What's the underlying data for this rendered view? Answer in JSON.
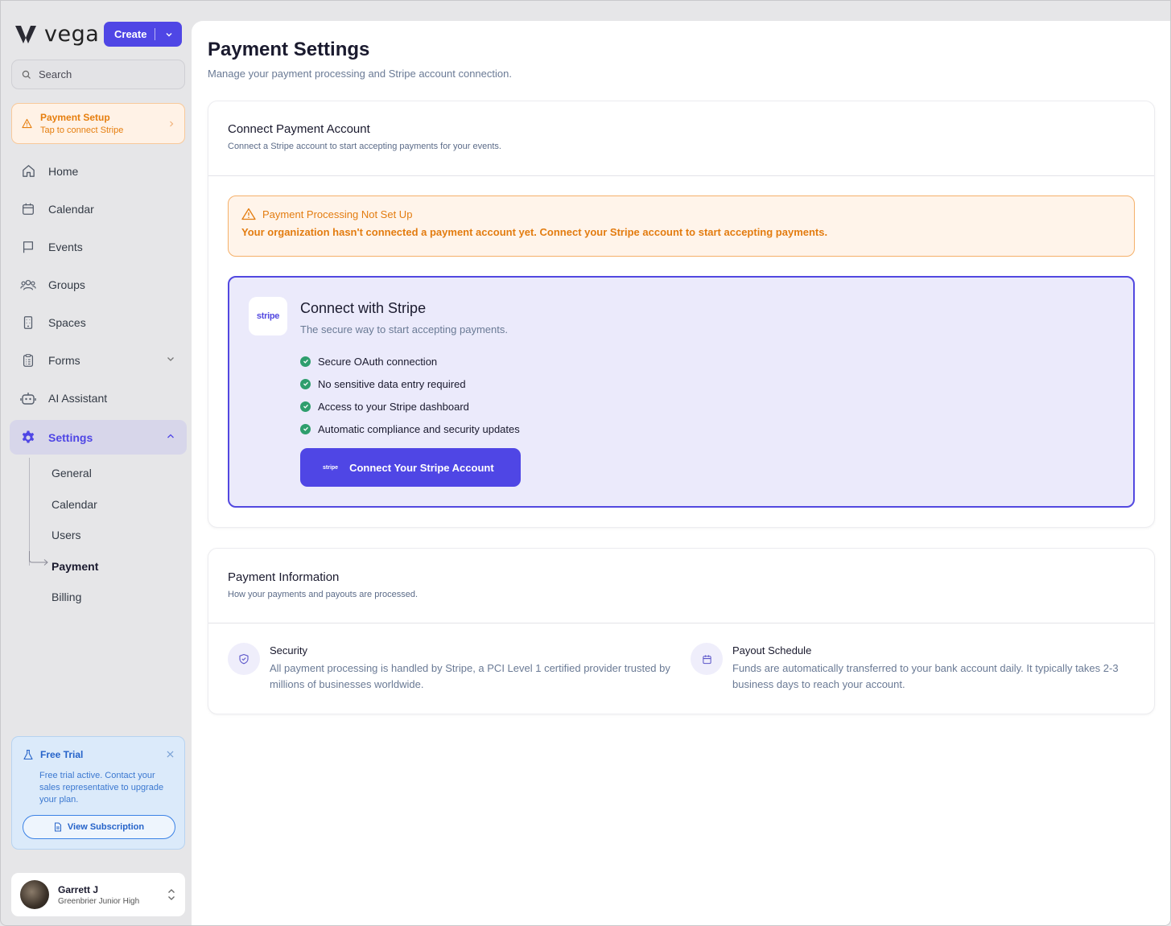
{
  "brand": {
    "name": "vega"
  },
  "create": {
    "label": "Create"
  },
  "search": {
    "placeholder": "Search"
  },
  "payment_setup": {
    "title": "Payment Setup",
    "subtitle": "Tap to connect Stripe"
  },
  "nav": {
    "home": "Home",
    "calendar": "Calendar",
    "events": "Events",
    "groups": "Groups",
    "spaces": "Spaces",
    "forms": "Forms",
    "ai_assistant": "AI Assistant",
    "settings": "Settings"
  },
  "subnav": {
    "general": "General",
    "calendar": "Calendar",
    "users": "Users",
    "payment": "Payment",
    "billing": "Billing"
  },
  "trial": {
    "title": "Free Trial",
    "body": "Free trial active. Contact your sales representative to upgrade your plan.",
    "button": "View Subscription"
  },
  "user": {
    "name": "Garrett J",
    "org": "Greenbrier Junior High"
  },
  "page": {
    "title": "Payment Settings",
    "subtitle": "Manage your payment processing and Stripe account connection."
  },
  "connect_card": {
    "title": "Connect Payment Account",
    "subtitle": "Connect a Stripe account to start accepting payments for your events.",
    "warning_title": "Payment Processing Not Set Up",
    "warning_body": "Your organization hasn't connected a payment account yet. Connect your Stripe account to start accepting payments.",
    "stripe_logo": "stripe",
    "stripe_title": "Connect with Stripe",
    "stripe_subtitle": "The secure way to start accepting payments.",
    "features": [
      "Secure OAuth connection",
      "No sensitive data entry required",
      "Access to your Stripe dashboard",
      "Automatic compliance and security updates"
    ],
    "button_logo": "stripe",
    "button_label": "Connect Your Stripe Account"
  },
  "info_card": {
    "title": "Payment Information",
    "subtitle": "How your payments and payouts are processed.",
    "security_title": "Security",
    "security_body": "All payment processing is handled by Stripe, a PCI Level 1 certified provider trusted by millions of businesses worldwide.",
    "payout_title": "Payout Schedule",
    "payout_body": "Funds are automatically transferred to your bank account daily. It typically takes 2-3 business days to reach your account."
  },
  "colors": {
    "accent": "#4f46e5",
    "warning": "#e37c10",
    "success": "#2e9e6d",
    "trial": "#2563c9"
  }
}
